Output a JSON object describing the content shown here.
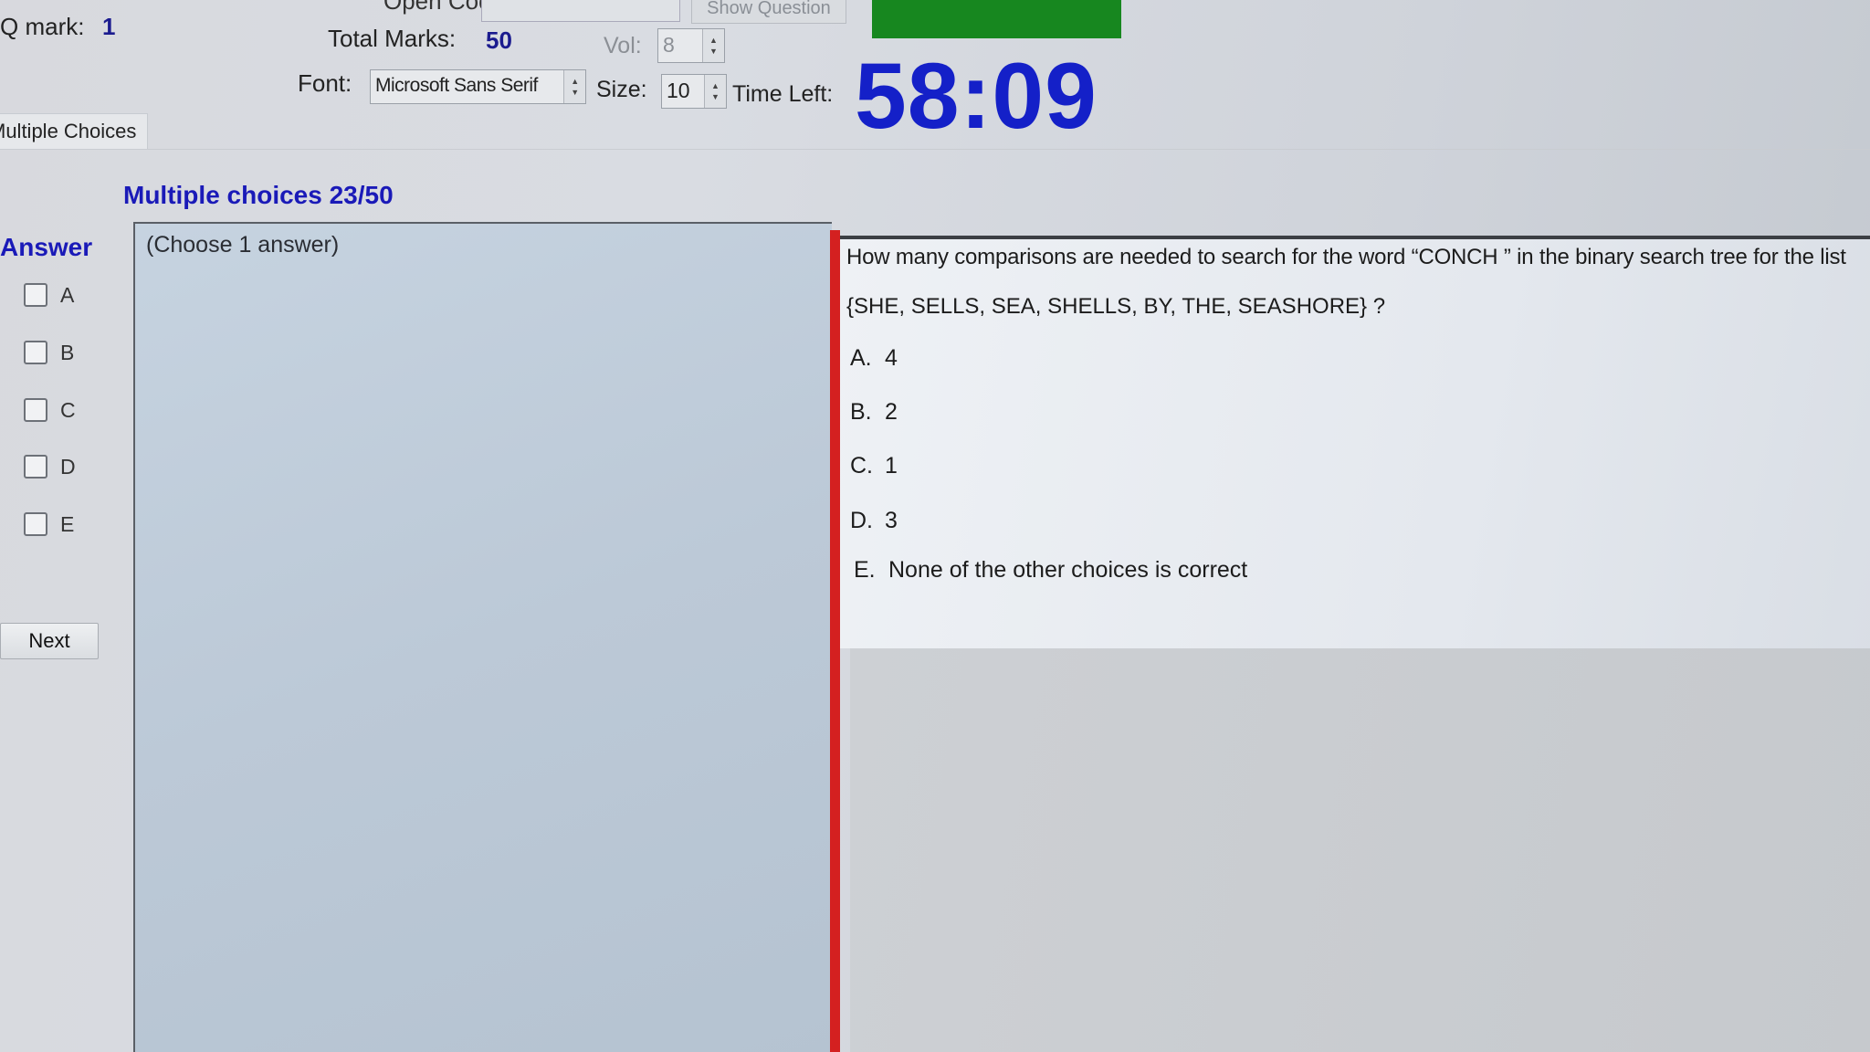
{
  "header": {
    "q_mark_label": "Q mark:",
    "q_mark_value": "1",
    "open_code_label": "Open Code:",
    "open_code_value": "",
    "show_question_label": "Show Question",
    "total_marks_label": "Total Marks:",
    "total_marks_value": "50",
    "vol_label": "Vol:",
    "vol_value": "8",
    "font_label": "Font:",
    "font_value": "Microsoft Sans Serif",
    "size_label": "Size:",
    "size_value": "10",
    "time_left_label": "Time Left:",
    "time_left_value": "58:09",
    "status_color": "#17871f",
    "timer_color": "#1420c8"
  },
  "tabs": [
    {
      "label": "Multiple Choices",
      "active": true
    }
  ],
  "section": {
    "title": "Multiple choices 23/50"
  },
  "answer_panel": {
    "title": "Answer",
    "options": [
      {
        "letter": "A",
        "checked": false
      },
      {
        "letter": "B",
        "checked": false
      },
      {
        "letter": "C",
        "checked": false
      },
      {
        "letter": "D",
        "checked": false
      },
      {
        "letter": "E",
        "checked": false
      }
    ],
    "next_label": "Next"
  },
  "work_area": {
    "hint": "(Choose 1 answer)"
  },
  "question": {
    "line1": "How many comparisons are needed to search for the word “CONCH ” in the binary search tree for the list",
    "line2": "{SHE, SELLS, SEA, SHELLS, BY, THE, SEASHORE} ?",
    "choices": [
      {
        "letter": "A.",
        "text": "4"
      },
      {
        "letter": "B.",
        "text": "2"
      },
      {
        "letter": "C.",
        "text": "1"
      },
      {
        "letter": "D.",
        "text": "3"
      },
      {
        "letter": "E.",
        "text": "None of the other choices is correct"
      }
    ]
  }
}
